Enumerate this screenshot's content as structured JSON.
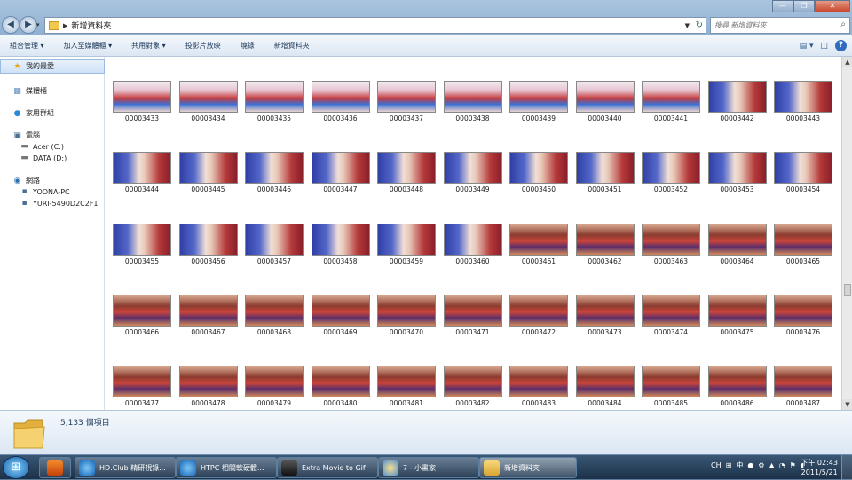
{
  "window": {
    "path_label": "新增資料夾",
    "search_placeholder": "搜尋 新增資料夾",
    "caption": {
      "minimize": "—",
      "maximize": "❐",
      "close": "✕"
    }
  },
  "toolbar": {
    "items": [
      "組合管理 ▾",
      "加入至媒體櫃 ▾",
      "共用對象 ▾",
      "投影片放映",
      "燒錄",
      "新增資料夾"
    ]
  },
  "nav": {
    "favorites": "我的最愛",
    "libraries": "媒體櫃",
    "homegroup": "家用群組",
    "computer": "電腦",
    "drive_c": "Acer (C:)",
    "drive_d": "DATA (D:)",
    "network": "網路",
    "pc1": "YOONA-PC",
    "pc2": "YURI-5490D2C2F1"
  },
  "files": [
    {
      "name": "00003433",
      "scene": "stage"
    },
    {
      "name": "00003434",
      "scene": "stage"
    },
    {
      "name": "00003435",
      "scene": "stage"
    },
    {
      "name": "00003436",
      "scene": "stage"
    },
    {
      "name": "00003437",
      "scene": "stage"
    },
    {
      "name": "00003438",
      "scene": "stage"
    },
    {
      "name": "00003439",
      "scene": "stage"
    },
    {
      "name": "00003440",
      "scene": "stage"
    },
    {
      "name": "00003441",
      "scene": "stage"
    },
    {
      "name": "00003442",
      "scene": "portrait"
    },
    {
      "name": "00003443",
      "scene": "portrait"
    },
    {
      "name": "00003444",
      "scene": "portrait"
    },
    {
      "name": "00003445",
      "scene": "portrait"
    },
    {
      "name": "00003446",
      "scene": "portrait"
    },
    {
      "name": "00003447",
      "scene": "portrait"
    },
    {
      "name": "00003448",
      "scene": "portrait"
    },
    {
      "name": "00003449",
      "scene": "portrait"
    },
    {
      "name": "00003450",
      "scene": "portrait"
    },
    {
      "name": "00003451",
      "scene": "portrait"
    },
    {
      "name": "00003452",
      "scene": "portrait"
    },
    {
      "name": "00003453",
      "scene": "portrait"
    },
    {
      "name": "00003454",
      "scene": "portrait"
    },
    {
      "name": "00003455",
      "scene": "portrait"
    },
    {
      "name": "00003456",
      "scene": "portrait"
    },
    {
      "name": "00003457",
      "scene": "portrait"
    },
    {
      "name": "00003458",
      "scene": "portrait"
    },
    {
      "name": "00003459",
      "scene": "portrait"
    },
    {
      "name": "00003460",
      "scene": "portrait"
    },
    {
      "name": "00003461",
      "scene": "dance"
    },
    {
      "name": "00003462",
      "scene": "dance"
    },
    {
      "name": "00003463",
      "scene": "dance"
    },
    {
      "name": "00003464",
      "scene": "dance"
    },
    {
      "name": "00003465",
      "scene": "dance"
    },
    {
      "name": "00003466",
      "scene": "dance"
    },
    {
      "name": "00003467",
      "scene": "dance"
    },
    {
      "name": "00003468",
      "scene": "dance"
    },
    {
      "name": "00003469",
      "scene": "dance"
    },
    {
      "name": "00003470",
      "scene": "dance"
    },
    {
      "name": "00003471",
      "scene": "dance"
    },
    {
      "name": "00003472",
      "scene": "dance"
    },
    {
      "name": "00003473",
      "scene": "dance"
    },
    {
      "name": "00003474",
      "scene": "dance"
    },
    {
      "name": "00003475",
      "scene": "dance"
    },
    {
      "name": "00003476",
      "scene": "dance"
    },
    {
      "name": "00003477",
      "scene": "dance"
    },
    {
      "name": "00003478",
      "scene": "dance"
    },
    {
      "name": "00003479",
      "scene": "dance"
    },
    {
      "name": "00003480",
      "scene": "dance"
    },
    {
      "name": "00003481",
      "scene": "dance"
    },
    {
      "name": "00003482",
      "scene": "dance"
    },
    {
      "name": "00003483",
      "scene": "dance"
    },
    {
      "name": "00003484",
      "scene": "dance"
    },
    {
      "name": "00003485",
      "scene": "dance"
    },
    {
      "name": "00003486",
      "scene": "dance"
    },
    {
      "name": "00003487",
      "scene": "dance"
    }
  ],
  "details": {
    "count": "5,133 個項目"
  },
  "taskbar": {
    "tasks": [
      {
        "label": "HD.Club 精研視錄...",
        "icon": "ie-icon"
      },
      {
        "label": "HTPC 相關軟硬體...",
        "icon": "ie-icon"
      },
      {
        "label": "Extra Movie to Gif",
        "icon": "film-icon"
      },
      {
        "label": "7 - 小畫家",
        "icon": "paint-icon"
      },
      {
        "label": "新增資料夾",
        "icon": "folder-icon"
      }
    ],
    "lang": "CH",
    "ime": "中",
    "time": "下午 02:43",
    "date": "2011/5/21"
  },
  "colors": {
    "accent": "#1e395b",
    "taskbar": "#1c3148"
  }
}
